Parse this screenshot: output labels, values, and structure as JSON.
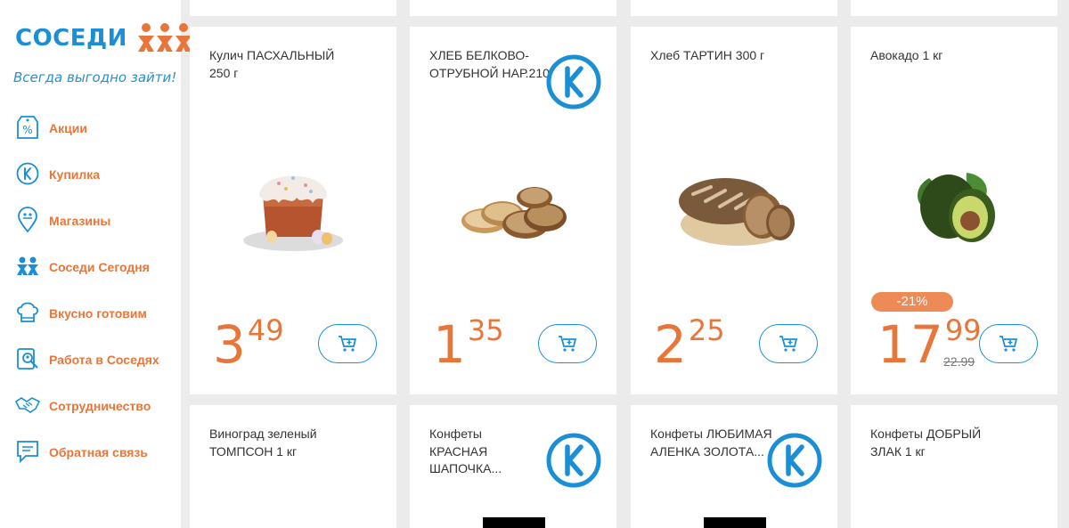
{
  "brand": {
    "name": "СОСЕДИ",
    "tagline": "Всегда выгодно зайти!",
    "accent": "#e8763a",
    "brand_blue": "#1a8fd6"
  },
  "sidebar": {
    "items": [
      {
        "label": "Акции",
        "icon": "percent-tag-icon"
      },
      {
        "label": "Купилка",
        "icon": "kupilka-k-icon"
      },
      {
        "label": "Магазины",
        "icon": "map-pin-icon"
      },
      {
        "label": "Соседи Сегодня",
        "icon": "people-icon"
      },
      {
        "label": "Вкусно готовим",
        "icon": "chef-hat-icon"
      },
      {
        "label": "Работа в Соседях",
        "icon": "job-search-icon"
      },
      {
        "label": "Сотрудничество",
        "icon": "handshake-icon"
      },
      {
        "label": "Обратная связь",
        "icon": "chat-icon"
      }
    ]
  },
  "products": [
    {
      "name": "Кулич ПАСХАЛЬНЫЙ 250 г",
      "price_int": "3",
      "price_dec": "49",
      "image": "easter-cake-image"
    },
    {
      "name": "ХЛЕБ БЕЛКОВО-ОТРУБНОЙ НАР.210Г",
      "price_int": "1",
      "price_dec": "35",
      "image": "sliced-bread-image",
      "kupilka": true
    },
    {
      "name": "Хлеб ТАРТИН 300 г",
      "price_int": "2",
      "price_dec": "25",
      "image": "rustic-bread-image"
    },
    {
      "name": "Авокадо 1 кг",
      "price_int": "17",
      "price_dec": "99",
      "old_price": "22.99",
      "discount": "-21%",
      "image": "avocado-image"
    },
    {
      "name": "Виноград зеленый ТОМПСОН 1 кг"
    },
    {
      "name": "Конфеты КРАСНАЯ ШАПОЧКА...",
      "kupilka": true
    },
    {
      "name": "Конфеты ЛЮБИМАЯ АЛЕНКА ЗОЛОТА...",
      "kupilka": true
    },
    {
      "name": "Конфеты ДОБРЫЙ ЗЛАК 1 кг"
    }
  ]
}
